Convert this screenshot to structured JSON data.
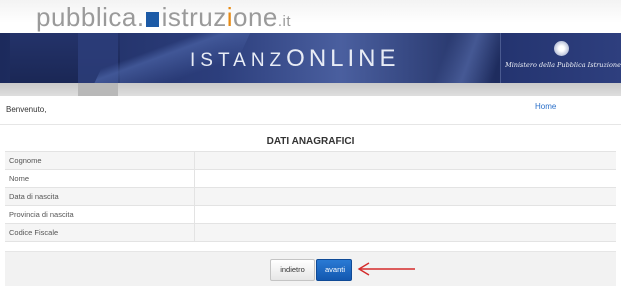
{
  "header": {
    "portal_name_part1": "pubblica.",
    "portal_name_part2": "istruz",
    "portal_name_part3": "i",
    "portal_name_part4": "one",
    "portal_tld": ".it",
    "app_name_part1": "ISTANZ",
    "app_name_part2": "ONLINE",
    "ministry": "Ministero della Pubblica Istruzione"
  },
  "welcome": {
    "text": "Benvenuto,",
    "home_link": "Home"
  },
  "section": {
    "title": "DATI ANAGRAFICI",
    "rows": [
      {
        "label": "Cognome",
        "value": ""
      },
      {
        "label": "Nome",
        "value": ""
      },
      {
        "label": "Data di nascita",
        "value": ""
      },
      {
        "label": "Provincia di nascita",
        "value": ""
      },
      {
        "label": "Codice Fiscale",
        "value": ""
      }
    ]
  },
  "actions": {
    "back_label": "indietro",
    "next_label": "avanti"
  },
  "colors": {
    "link": "#2a6fc9",
    "primary_button": "#1a66c2",
    "arrow": "#d42a2a",
    "banner": "#24336a"
  }
}
